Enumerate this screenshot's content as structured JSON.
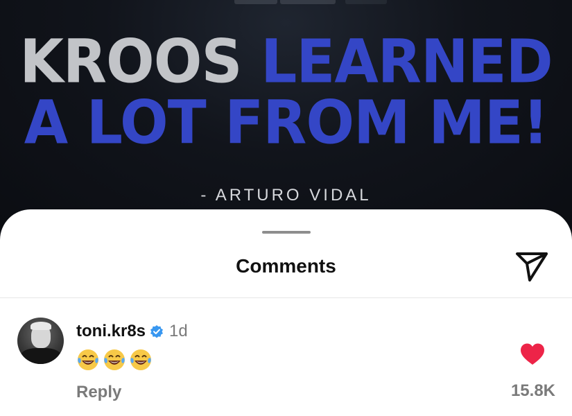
{
  "post": {
    "top_text": "",
    "headline_word1": "KROOS",
    "headline_word2": "LEARNED",
    "headline_line2": "A LOT FROM ME!",
    "attribution": "- ARTURO VIDAL",
    "colors": {
      "grey_text": "#c2c4c8",
      "blue_text": "#3446c6",
      "background": "#0d0f14"
    }
  },
  "sheet": {
    "title": "Comments",
    "share_icon": "paper-plane-icon"
  },
  "comments": [
    {
      "username": "toni.kr8s",
      "verified": true,
      "time": "1d",
      "text": "😂😂😂",
      "reply_label": "Reply",
      "like_count": "15.8K",
      "liked": true,
      "like_color": "#ed2448"
    }
  ]
}
